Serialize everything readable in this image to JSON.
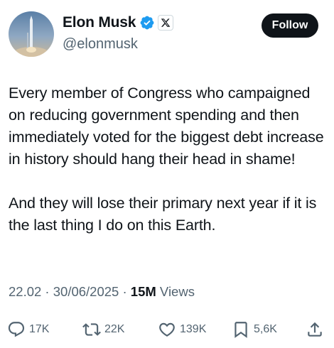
{
  "header": {
    "display_name": "Elon Musk",
    "handle": "@elonmusk",
    "follow_label": "Follow"
  },
  "tweet": {
    "paragraphs": [
      "Every member of Congress who campaigned on reducing government spending and then immediately voted for the biggest debt increase in history should hang their head in shame!",
      "And they will lose their primary next year if it is the last thing I do on this Earth."
    ]
  },
  "meta": {
    "time": "22.02",
    "sep1": " · ",
    "date": "30/06/2025",
    "sep2": " · ",
    "views_count": "15M",
    "views_label": " Views"
  },
  "actions": {
    "replies": "17K",
    "reposts": "22K",
    "likes": "139K",
    "bookmarks": "5,6K"
  },
  "colors": {
    "verified": "#1d9bf0",
    "text": "#0f1419",
    "secondary": "#536471",
    "follow_bg": "#0f1419"
  },
  "icons": {
    "avatar": "rocket-launch-avatar",
    "verified": "verified-badge-icon",
    "affiliate": "x-logo-icon",
    "reply": "reply-icon",
    "repost": "repost-icon",
    "like": "heart-icon",
    "bookmark": "bookmark-icon",
    "share": "share-icon"
  }
}
